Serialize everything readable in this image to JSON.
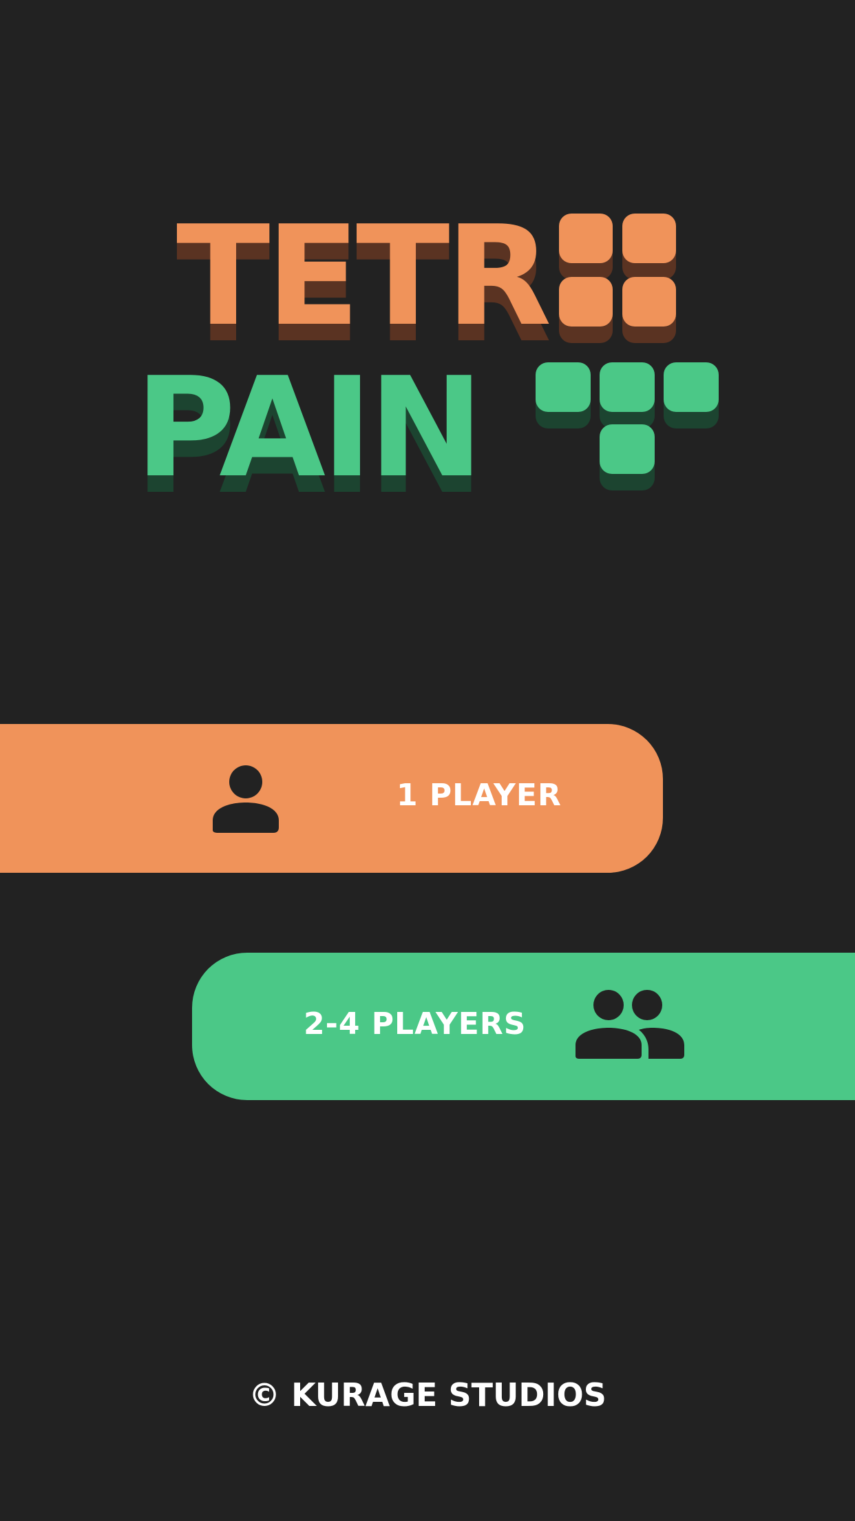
{
  "logo": {
    "line1": "TETR",
    "line2": "PAIN"
  },
  "menu": {
    "single_player_label": "1 PLAYER",
    "multi_player_label": "2-4 PLAYERS"
  },
  "icons": {
    "single_player": "person-icon",
    "multi_player": "group-icon"
  },
  "footer": {
    "copyright": "© KURAGE STUDIOS"
  },
  "colors": {
    "background": "#222222",
    "orange": "#F0935A",
    "orange_shadow": "#5A3322",
    "green": "#4BC887",
    "green_shadow": "#1C4430",
    "text": "#FFFFFF",
    "icon": "#222222"
  }
}
